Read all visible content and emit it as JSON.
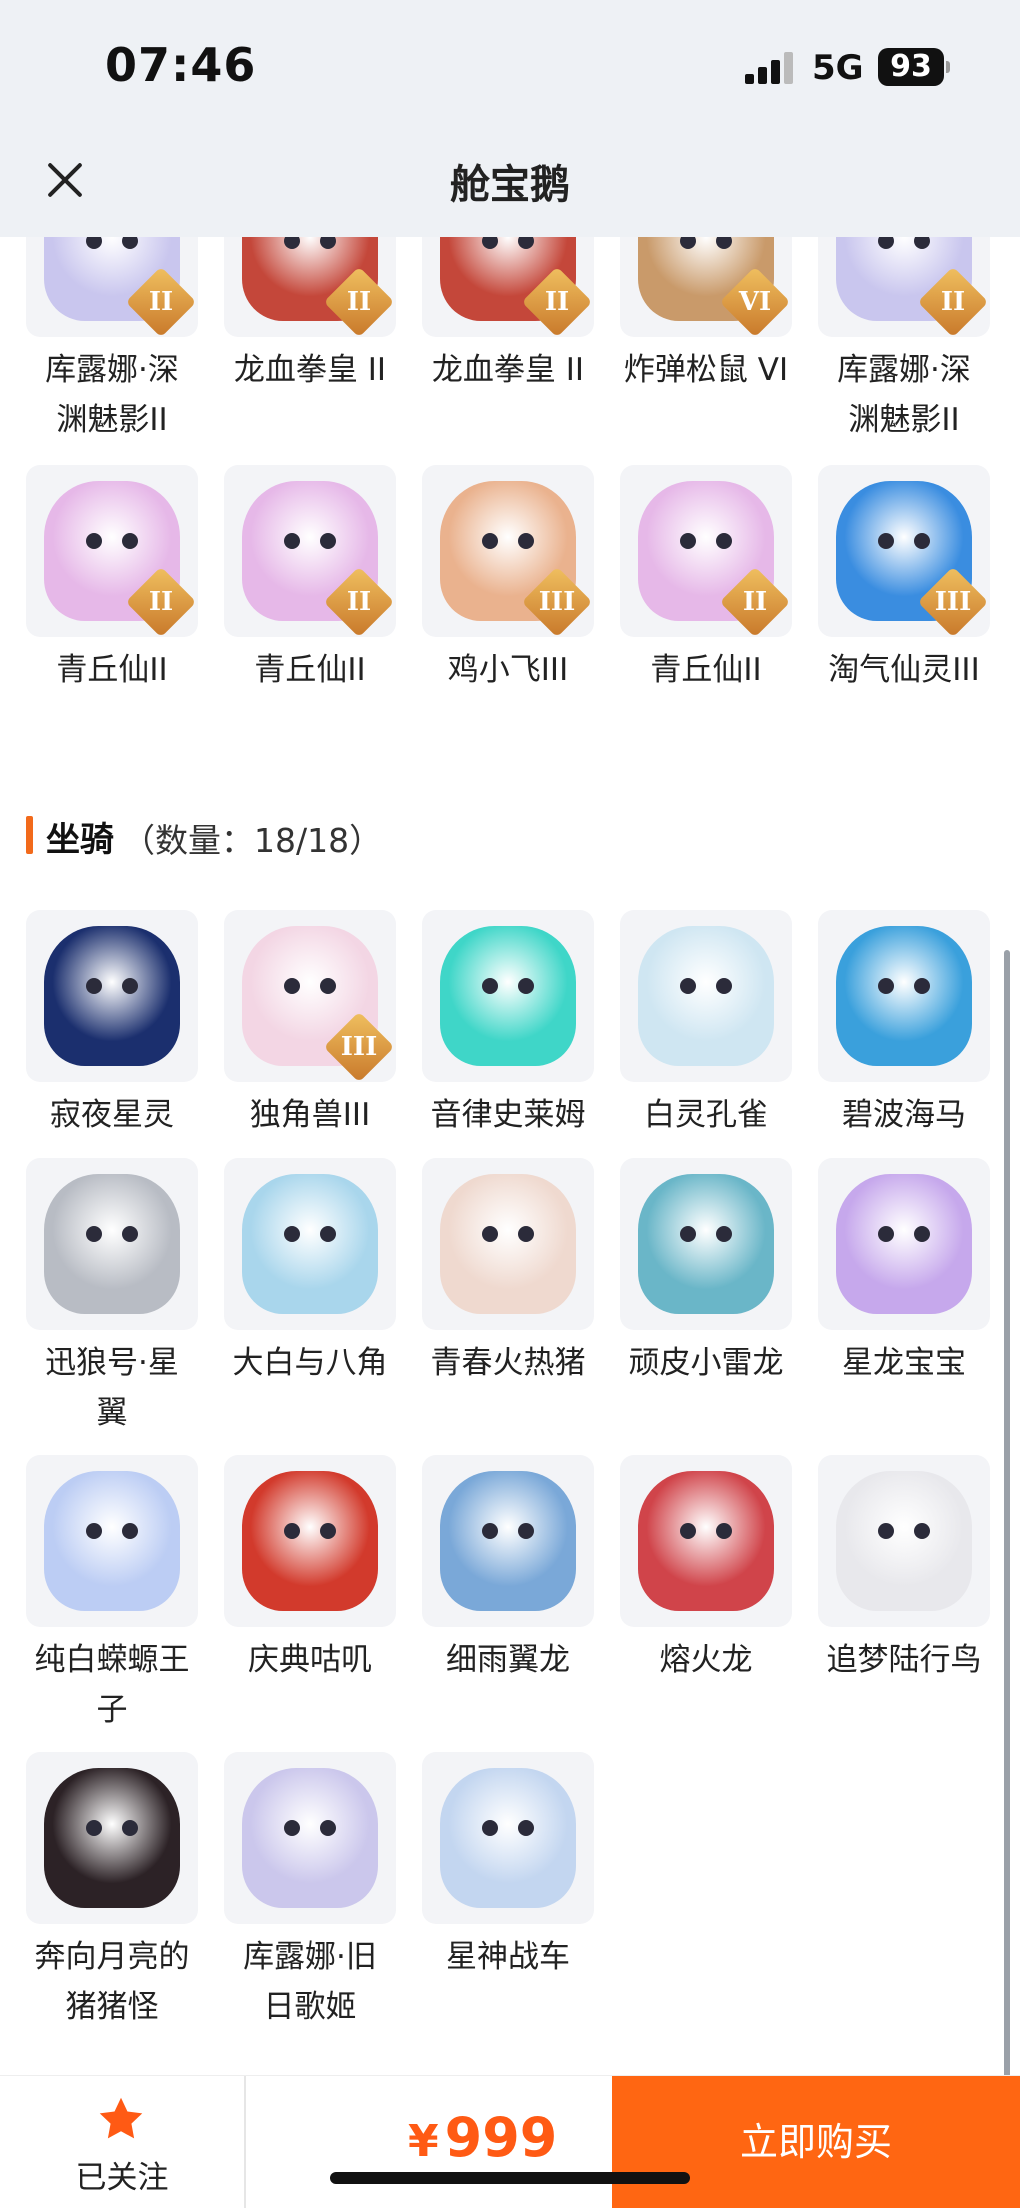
{
  "status_bar": {
    "time": "07:46",
    "network": "5G",
    "battery": "93"
  },
  "nav": {
    "title": "舱宝鹅"
  },
  "top_rows": [
    [
      {
        "name": "库露娜·深渊魅影II",
        "lines": [
          "库露娜·深",
          "渊魅影II"
        ],
        "badge": "II",
        "color": "#c9c6ee"
      },
      {
        "name": "龙血拳皇 II",
        "lines": [
          "龙血拳皇 II"
        ],
        "badge": "II",
        "color": "#c4473a"
      },
      {
        "name": "龙血拳皇 II",
        "lines": [
          "龙血拳皇 II"
        ],
        "badge": "II",
        "color": "#c4473a"
      },
      {
        "name": "炸弹松鼠 VI",
        "lines": [
          "炸弹松鼠 VI"
        ],
        "badge": "VI",
        "color": "#c99a6a"
      },
      {
        "name": "库露娜·深渊魅影II",
        "lines": [
          "库露娜·深",
          "渊魅影II"
        ],
        "badge": "II",
        "color": "#c9c6ee"
      }
    ],
    [
      {
        "name": "青丘仙II",
        "lines": [
          "青丘仙II"
        ],
        "badge": "II",
        "color": "#e6b8e8"
      },
      {
        "name": "青丘仙II",
        "lines": [
          "青丘仙II"
        ],
        "badge": "II",
        "color": "#e6b8e8"
      },
      {
        "name": "鸡小飞III",
        "lines": [
          "鸡小飞III"
        ],
        "badge": "III",
        "color": "#eab28e"
      },
      {
        "name": "青丘仙II",
        "lines": [
          "青丘仙II"
        ],
        "badge": "II",
        "color": "#e6b8e8"
      },
      {
        "name": "淘气仙灵III",
        "lines": [
          "淘气仙灵III"
        ],
        "badge": "III",
        "color": "#3a8de0"
      }
    ]
  ],
  "mounts_section": {
    "title": "坐骑",
    "count_text": "（数量：18/18）"
  },
  "mounts": [
    {
      "name": "寂夜星灵",
      "lines": [
        "寂夜星灵"
      ],
      "badge": "",
      "color": "#1b2f6e"
    },
    {
      "name": "独角兽III",
      "lines": [
        "独角兽III"
      ],
      "badge": "III",
      "color": "#f3d6e4"
    },
    {
      "name": "音律史莱姆",
      "lines": [
        "音律史莱姆"
      ],
      "badge": "",
      "color": "#3fd6c8"
    },
    {
      "name": "白灵孔雀",
      "lines": [
        "白灵孔雀"
      ],
      "badge": "",
      "color": "#cfe6f2"
    },
    {
      "name": "碧波海马",
      "lines": [
        "碧波海马"
      ],
      "badge": "",
      "color": "#3aa0dc"
    },
    {
      "name": "迅狼号·星翼",
      "lines": [
        "迅狼号·星",
        "翼"
      ],
      "badge": "",
      "color": "#b8bcc4"
    },
    {
      "name": "大白与八角",
      "lines": [
        "大白与八角"
      ],
      "badge": "",
      "color": "#a9d6ec"
    },
    {
      "name": "青春火热猪",
      "lines": [
        "青春火热猪"
      ],
      "badge": "",
      "color": "#efd9cf"
    },
    {
      "name": "顽皮小雷龙",
      "lines": [
        "顽皮小雷龙"
      ],
      "badge": "",
      "color": "#6ab6c8"
    },
    {
      "name": "星龙宝宝",
      "lines": [
        "星龙宝宝"
      ],
      "badge": "",
      "color": "#c6a8ec"
    },
    {
      "name": "纯白蝾螈王子",
      "lines": [
        "纯白蝾螈王",
        "子"
      ],
      "badge": "",
      "color": "#bccdf4"
    },
    {
      "name": "庆典咕叽",
      "lines": [
        "庆典咕叽"
      ],
      "badge": "",
      "color": "#d23a2c"
    },
    {
      "name": "细雨翼龙",
      "lines": [
        "细雨翼龙"
      ],
      "badge": "",
      "color": "#7aa8d8"
    },
    {
      "name": "熔火龙",
      "lines": [
        "熔火龙"
      ],
      "badge": "",
      "color": "#d0444a"
    },
    {
      "name": "追梦陆行鸟",
      "lines": [
        "追梦陆行鸟"
      ],
      "badge": "",
      "color": "#e8e8ec"
    },
    {
      "name": "奔向月亮的猪猪怪",
      "lines": [
        "奔向月亮的",
        "猪猪怪"
      ],
      "badge": "",
      "color": "#2c2226"
    },
    {
      "name": "库露娜·旧日歌姬",
      "lines": [
        "库露娜·旧",
        "日歌姬"
      ],
      "badge": "",
      "color": "#cbc7ec"
    },
    {
      "name": "星神战车",
      "lines": [
        "星神战车"
      ],
      "badge": "",
      "color": "#c3d6f0"
    }
  ],
  "bottom_bar": {
    "follow_label": "已关注",
    "price_symbol": "¥",
    "price_value": "999",
    "buy_label": "立即购买"
  },
  "colors": {
    "accent": "#ff6612",
    "price": "#ff5a14",
    "section_bar": "#f26a1b",
    "star": "#ff5a14"
  }
}
